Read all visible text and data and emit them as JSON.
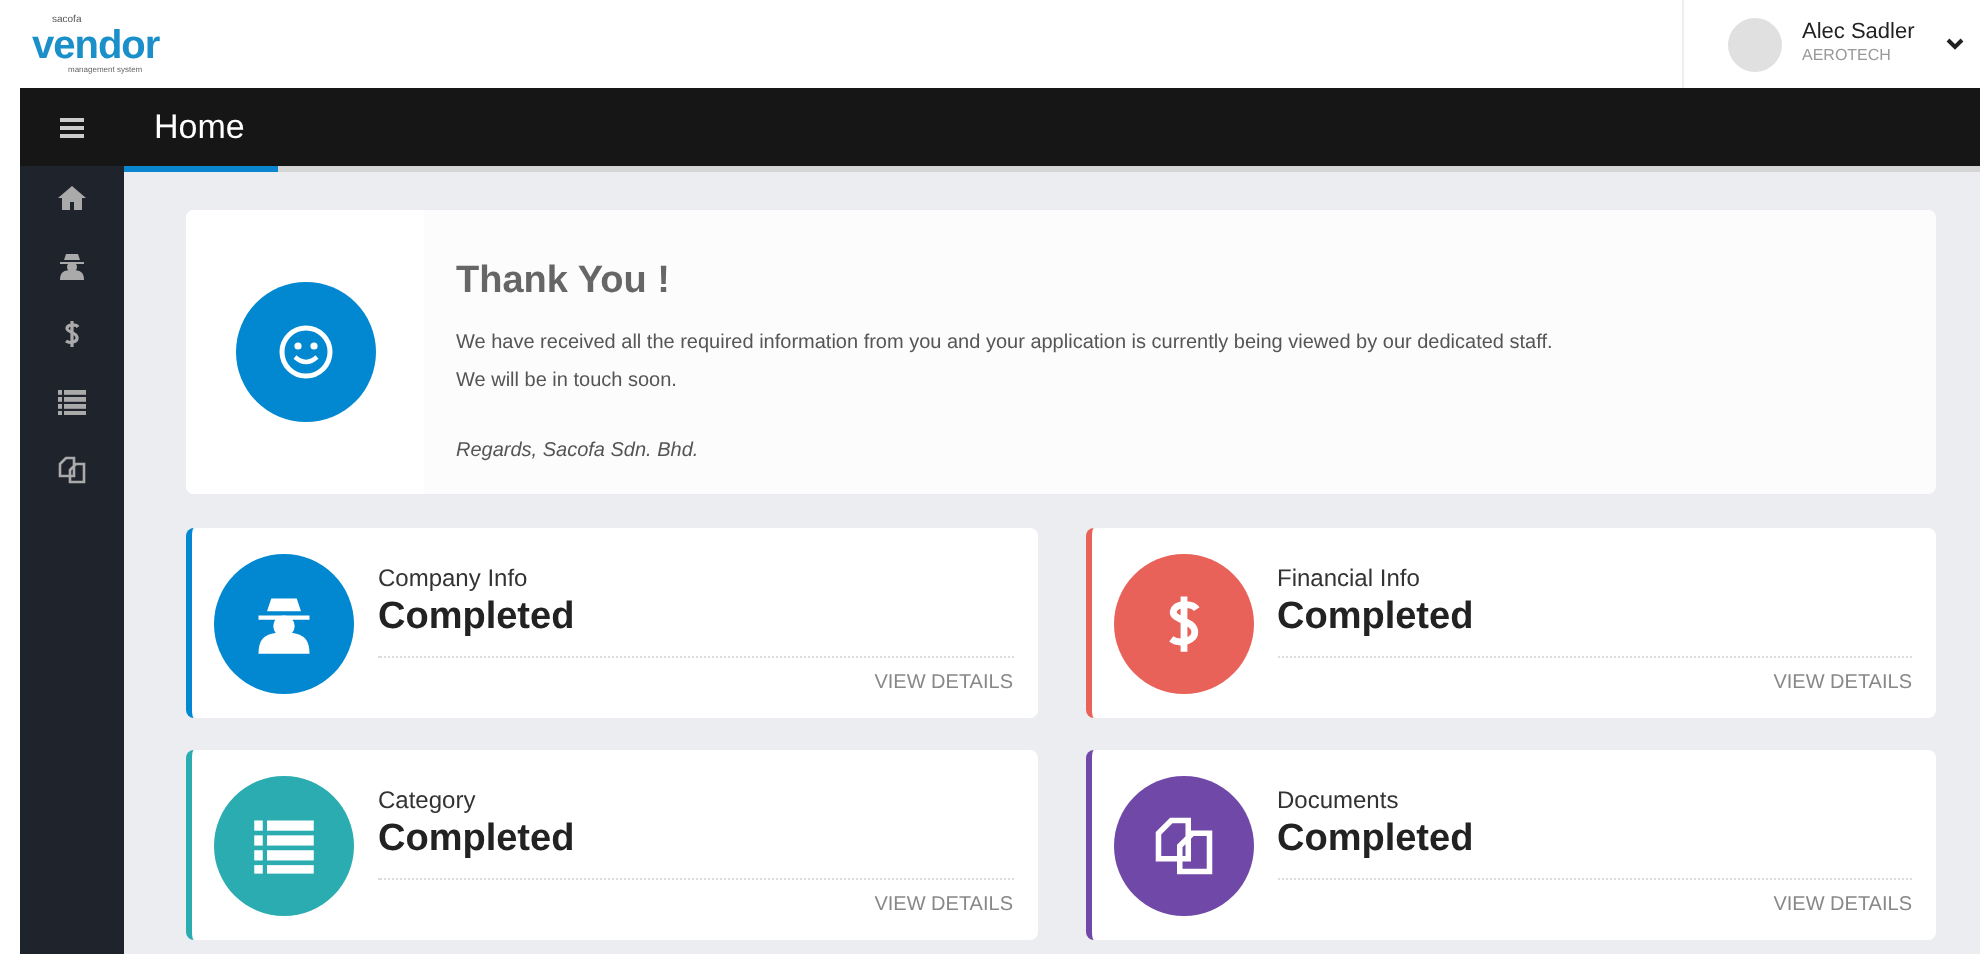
{
  "logo": {
    "top": "sacofa",
    "main": "vendor",
    "sub": "management system"
  },
  "user": {
    "name": "Alec Sadler",
    "company": "AEROTECH"
  },
  "page_title": "Home",
  "message": {
    "title": "Thank You !",
    "lines": [
      "We have received all the required information from you and your application is currently being viewed by our dedicated staff.",
      "We will be in touch soon."
    ],
    "signature": "Regards, Sacofa Sdn. Bhd."
  },
  "cards": [
    {
      "label": "Company Info",
      "status": "Completed",
      "link": "VIEW DETAILS",
      "color": "#0288d1"
    },
    {
      "label": "Financial Info",
      "status": "Completed",
      "link": "VIEW DETAILS",
      "color": "#e8625a"
    },
    {
      "label": "Category",
      "status": "Completed",
      "link": "VIEW DETAILS",
      "color": "#2aacb0"
    },
    {
      "label": "Documents",
      "status": "Completed",
      "link": "VIEW DETAILS",
      "color": "#7049a8"
    }
  ]
}
